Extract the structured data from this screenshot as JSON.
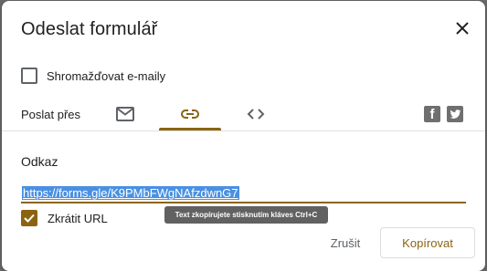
{
  "dialog": {
    "title": "Odeslat formulář",
    "collect_emails_label": "Shromažďovat e-maily",
    "collect_emails_checked": false,
    "send_via_label": "Poslat přes",
    "tabs": [
      {
        "icon": "mail-icon",
        "selected": false
      },
      {
        "icon": "link-icon",
        "selected": true
      },
      {
        "icon": "code-icon",
        "selected": false
      }
    ],
    "social": [
      "facebook-icon",
      "twitter-icon"
    ],
    "link_section_title": "Odkaz",
    "url": "https://forms.gle/K9PMbFWgNAfzdwnG7",
    "shorten_label": "Zkrátit URL",
    "shorten_checked": true,
    "tooltip": "Text zkopírujete stisknutím kláves Ctrl+C",
    "cancel_label": "Zrušit",
    "copy_label": "Kopírovat"
  },
  "colors": {
    "accent": "#8a6410",
    "icon_gray": "#5f6368",
    "selection": "#4a90e2"
  }
}
